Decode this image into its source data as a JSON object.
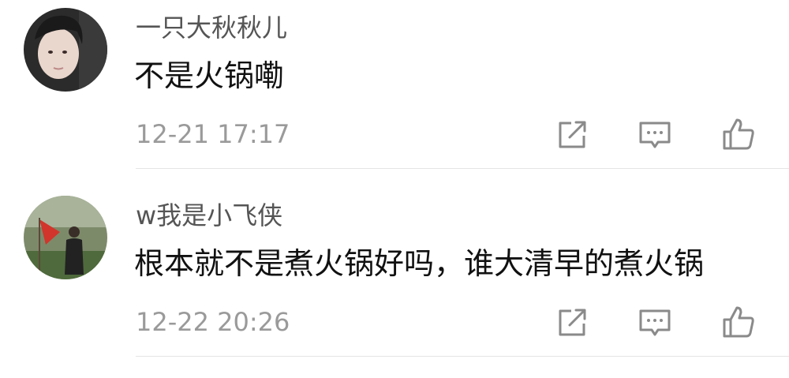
{
  "comments": [
    {
      "username": "一只大秋秋儿",
      "text": "不是火锅嘞",
      "timestamp": "12-21 17:17",
      "avatar_icon": "user-avatar"
    },
    {
      "username": "w我是小飞侠",
      "text": "根本就不是煮火锅好吗，谁大清早的煮火锅",
      "timestamp": "12-22 20:26",
      "avatar_icon": "user-avatar"
    }
  ],
  "actions": {
    "share_icon": "share-icon",
    "reply_icon": "reply-icon",
    "like_icon": "thumbs-up-icon"
  },
  "colors": {
    "username": "#555555",
    "text": "#111111",
    "timestamp": "#9a9a9a",
    "icon": "#8a8a8a",
    "divider": "#e4e4e4"
  }
}
